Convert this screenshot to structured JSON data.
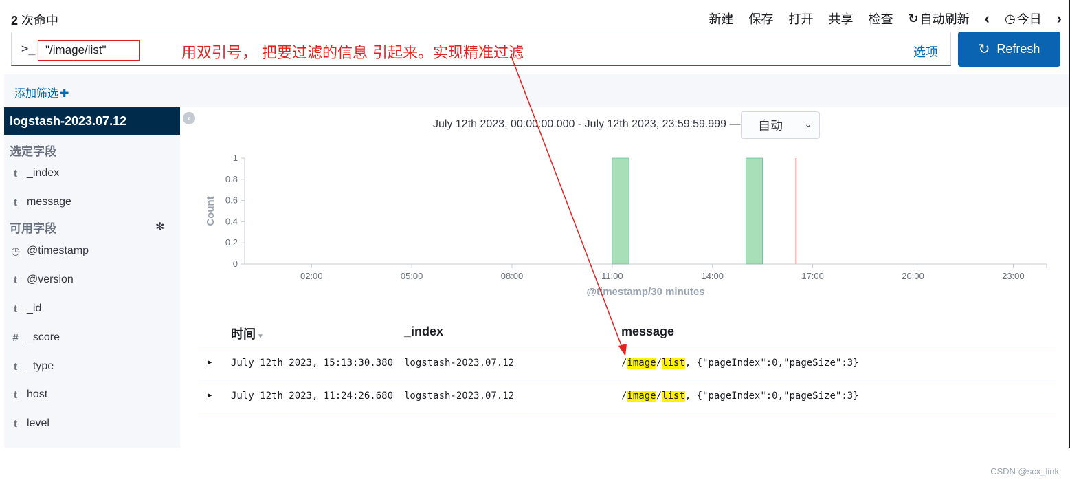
{
  "hits": {
    "count": "2",
    "label": " 次命中"
  },
  "top_menu": {
    "new": "新建",
    "save": "保存",
    "open": "打开",
    "share": "共享",
    "inspect": "检查",
    "auto_refresh": "自动刷新",
    "today": "今日"
  },
  "query": {
    "prompt": ">_",
    "value": "\"/image/list\"",
    "options_label": "选项"
  },
  "annotation": "用双引号，  把要过滤的信息 引起来。实现精准过滤",
  "refresh_button": {
    "label": "Refresh"
  },
  "filter_bar": {
    "add_filter": "添加筛选"
  },
  "sidebar": {
    "index_pattern": "logstash-2023.07.12",
    "selected_title": "选定字段",
    "selected_fields": [
      {
        "type": "t",
        "name": "_index"
      },
      {
        "type": "t",
        "name": "message"
      }
    ],
    "available_title": "可用字段",
    "available_fields": [
      {
        "type": "clock",
        "name": "@timestamp"
      },
      {
        "type": "t",
        "name": "@version"
      },
      {
        "type": "t",
        "name": "_id"
      },
      {
        "type": "#",
        "name": "_score"
      },
      {
        "type": "t",
        "name": "_type"
      },
      {
        "type": "t",
        "name": "host"
      },
      {
        "type": "t",
        "name": "level"
      }
    ]
  },
  "time_range": "July 12th 2023, 00:00:00.000 - July 12th 2023, 23:59:59.999 —",
  "interval": {
    "value": "自动"
  },
  "chart_data": {
    "type": "bar",
    "x_unit": "hours",
    "xlim": [
      0,
      24
    ],
    "ylim": [
      0,
      1
    ],
    "yticks": [
      "0",
      "0.2",
      "0.4",
      "0.6",
      "0.8",
      "1"
    ],
    "xticks": [
      "02:00",
      "05:00",
      "08:00",
      "11:00",
      "14:00",
      "17:00",
      "20:00",
      "23:00"
    ],
    "ylabel": "Count",
    "xlabel": "@timestamp/30 minutes",
    "bars": [
      {
        "start": 11.0,
        "end": 11.5,
        "value": 1
      },
      {
        "start": 15.0,
        "end": 15.5,
        "value": 1
      }
    ],
    "now_marker": 16.5,
    "colors": {
      "bar": "#a8dfb9",
      "bar_stroke": "#54b399",
      "now": "#f0a4a4"
    }
  },
  "table": {
    "headers": {
      "time": "时间",
      "index": "_index",
      "message": "message"
    },
    "rows": [
      {
        "time": "July 12th 2023, 15:13:30.380",
        "index": "logstash-2023.07.12",
        "msg_pre": "/",
        "msg_hl1": "image",
        "msg_mid": "/",
        "msg_hl2": "list",
        "msg_post": ", {\"pageIndex\":0,\"pageSize\":3}"
      },
      {
        "time": "July 12th 2023, 11:24:26.680",
        "index": "logstash-2023.07.12",
        "msg_pre": "/",
        "msg_hl1": "image",
        "msg_mid": "/",
        "msg_hl2": "list",
        "msg_post": ", {\"pageIndex\":0,\"pageSize\":3}"
      }
    ]
  },
  "watermark": "CSDN @scx_link"
}
